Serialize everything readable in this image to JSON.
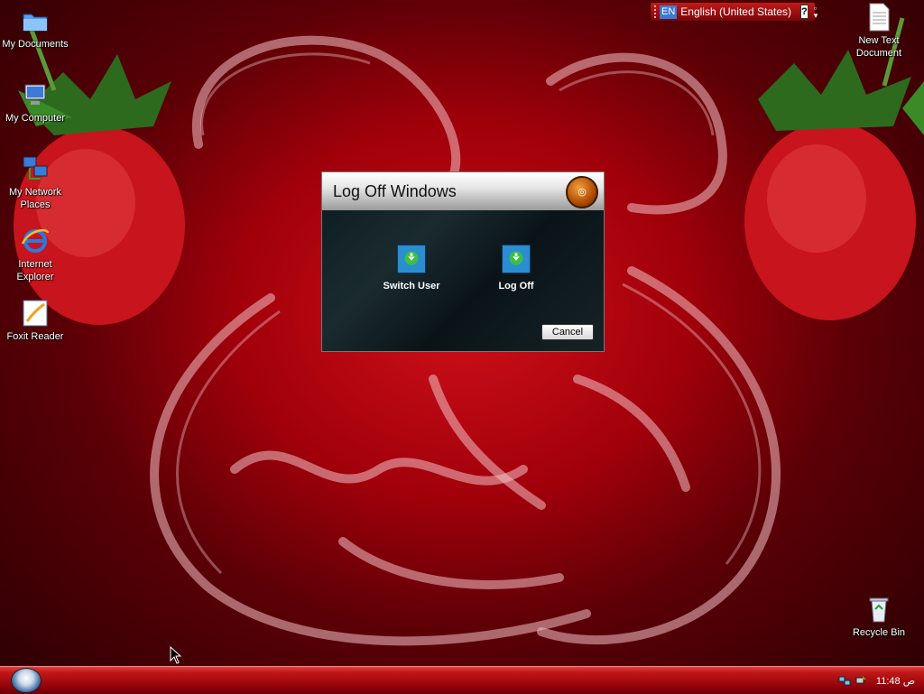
{
  "desktop": {
    "icons_left": [
      {
        "label": "My Documents",
        "icon": "folder-icon"
      },
      {
        "label": "My Computer",
        "icon": "computer-icon"
      },
      {
        "label": "My Network Places",
        "icon": "network-icon"
      },
      {
        "label": "Internet Explorer",
        "icon": "ie-icon"
      },
      {
        "label": "Foxit Reader",
        "icon": "pdf-reader-icon"
      }
    ],
    "icons_right": [
      {
        "label": "New Text Document",
        "icon": "text-file-icon"
      },
      {
        "label": "Recycle Bin",
        "icon": "recycle-bin-icon"
      }
    ]
  },
  "language_bar": {
    "code": "EN",
    "language": "English (United States)",
    "help": "?"
  },
  "dialog": {
    "title": "Log Off Windows",
    "switch_user_label": "Switch User",
    "log_off_label": "Log Off",
    "cancel_label": "Cancel"
  },
  "taskbar": {
    "clock": "11:48 ص"
  },
  "colors": {
    "desktop_bg": "#a0000a",
    "taskbar": "#c01818",
    "dialog_bg": "#1a2b30",
    "dialog_button": "#1a7ac0"
  }
}
